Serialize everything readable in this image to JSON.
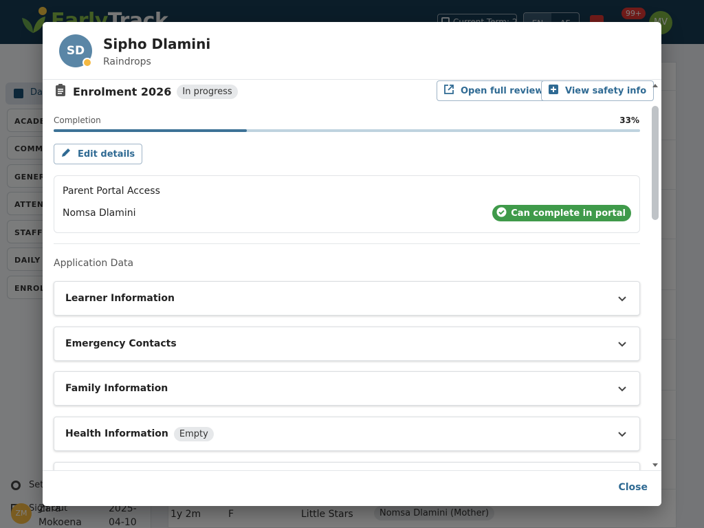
{
  "app": {
    "logo_text_a": "Early",
    "logo_text_b": "Track",
    "term_label": "Current Term: 2",
    "lang_en": "EN",
    "lang_af": "AF",
    "notification_count": "99+",
    "user_initials": "MV"
  },
  "sidebar": {
    "dashboard": "Dashboard",
    "groups": [
      "ACADEMICS",
      "COMMUNICATION",
      "GENERAL",
      "ATTENDANCE",
      "STAFF",
      "DAILY ROUTINE",
      "ENROLMENT"
    ],
    "settings": "Settings",
    "sign_out": "Sign Out"
  },
  "background_row": {
    "initials": "ZM",
    "name_line1": "Zara",
    "name_line2": "Mokoena",
    "date_line1": "2025-",
    "date_line2": "04-10",
    "age": "1y 2m",
    "gender": "F",
    "class": "Little Stars",
    "parent": "Nomsa Dlamini (Mother)"
  },
  "dialog": {
    "initials": "SD",
    "name": "Sipho Dlamini",
    "class": "Raindrops",
    "enrolment_title": "Enrolment 2026",
    "status": "In progress",
    "open_review": "Open full review",
    "view_safety": "View safety info",
    "completion_label": "Completion",
    "completion_pct": "33%",
    "completion_value": 0.33,
    "edit_details": "Edit details",
    "portal_title": "Parent Portal Access",
    "portal_parent": "Nomsa Dlamini",
    "portal_status": "Can complete in portal",
    "application_data": "Application Data",
    "sections": [
      {
        "label": "Learner Information",
        "badge": ""
      },
      {
        "label": "Emergency Contacts",
        "badge": ""
      },
      {
        "label": "Family Information",
        "badge": ""
      },
      {
        "label": "Health Information",
        "badge": "Empty"
      }
    ],
    "close": "Close"
  },
  "colors": {
    "primary": "#2f6a93",
    "success": "#3f9a4a",
    "header": "#173a53"
  }
}
